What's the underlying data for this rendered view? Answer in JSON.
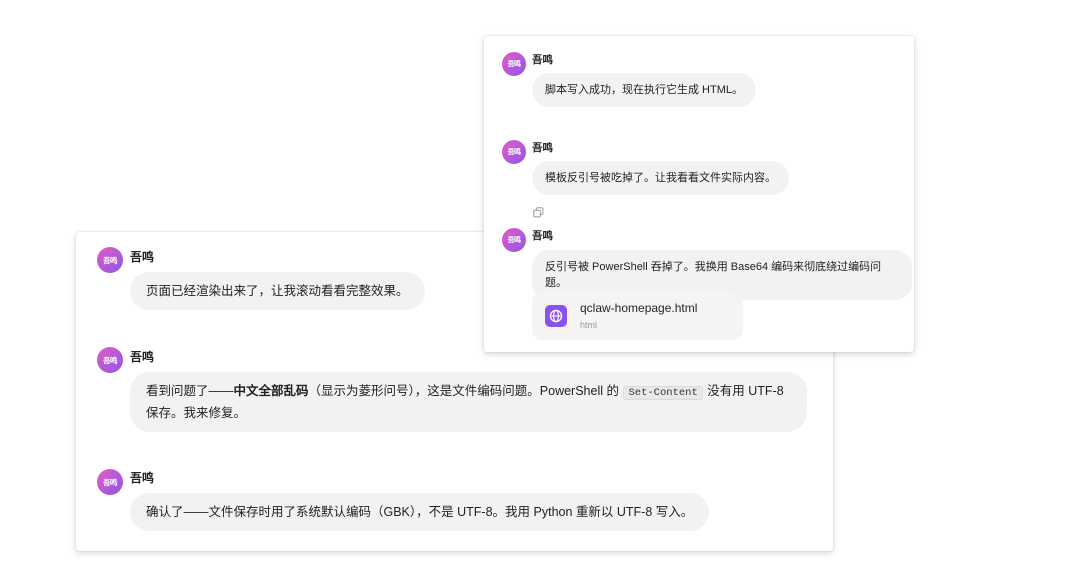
{
  "colors": {
    "avatar_gradient_start": "#e25bc6",
    "avatar_gradient_end": "#8f57e8",
    "bubble_background": "#f2f2f3",
    "file_icon_background": "#8a52ea"
  },
  "back_panel": {
    "messages": [
      {
        "sender": "吾鸣",
        "avatar_text": "吾鸣",
        "text": "页面已经渲染出来了，让我滚动看看完整效果。"
      },
      {
        "sender": "吾鸣",
        "avatar_text": "吾鸣",
        "parts": {
          "lead": "看到问题了——",
          "bold": "中文全部乱码",
          "middle": "（显示为菱形问号），这是文件编码问题。PowerShell 的 ",
          "code": "Set-Content",
          "tail": " 没有用 UTF-8 保存。我来修复。"
        }
      },
      {
        "sender": "吾鸣",
        "avatar_text": "吾鸣",
        "text": "确认了——文件保存时用了系统默认编码（GBK），不是 UTF-8。我用 Python 重新以 UTF-8 写入。"
      }
    ]
  },
  "front_panel": {
    "messages": [
      {
        "sender": "吾鸣",
        "avatar_text": "吾鸣",
        "text": "脚本写入成功，现在执行它生成 HTML。"
      },
      {
        "sender": "吾鸣",
        "avatar_text": "吾鸣",
        "text": "模板反引号被吃掉了。让我看看文件实际内容。",
        "action_icon": "copy-icon"
      },
      {
        "sender": "吾鸣",
        "avatar_text": "吾鸣",
        "text": "反引号被 PowerShell 吞掉了。我换用 Base64 编码来彻底绕过编码问题。",
        "attachment": {
          "icon": "globe-icon",
          "filename": "qclaw-homepage.html",
          "type": "html"
        }
      }
    ]
  }
}
